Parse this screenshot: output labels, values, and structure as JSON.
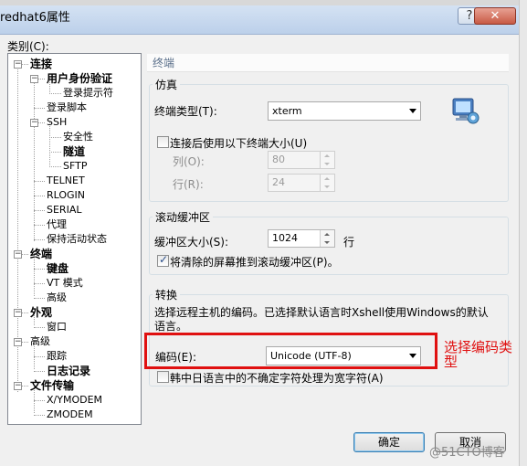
{
  "window": {
    "title": "redhat6属性",
    "help_glyph": "?",
    "close_glyph": "✕"
  },
  "category_label": "类别(C):",
  "tree": [
    {
      "label": "连接",
      "bold": true,
      "expander": "−"
    },
    {
      "label": "用户身份验证",
      "bold": true,
      "expander": "−"
    },
    {
      "label": "登录提示符",
      "bold": false
    },
    {
      "label": "登录脚本",
      "bold": false
    },
    {
      "label": "SSH",
      "bold": false,
      "expander": "−"
    },
    {
      "label": "安全性",
      "bold": false
    },
    {
      "label": "隧道",
      "bold": true
    },
    {
      "label": "SFTP",
      "bold": false
    },
    {
      "label": "TELNET",
      "bold": false
    },
    {
      "label": "RLOGIN",
      "bold": false
    },
    {
      "label": "SERIAL",
      "bold": false
    },
    {
      "label": "代理",
      "bold": false
    },
    {
      "label": "保持活动状态",
      "bold": false
    },
    {
      "label": "终端",
      "bold": true,
      "expander": "−"
    },
    {
      "label": "键盘",
      "bold": true
    },
    {
      "label": "VT 模式",
      "bold": false
    },
    {
      "label": "高级",
      "bold": false
    },
    {
      "label": "外观",
      "bold": true,
      "expander": "−"
    },
    {
      "label": "窗口",
      "bold": false
    },
    {
      "label": "高级",
      "bold": false,
      "expander": "−"
    },
    {
      "label": "跟踪",
      "bold": false
    },
    {
      "label": "日志记录",
      "bold": true
    },
    {
      "label": "文件传输",
      "bold": true,
      "expander": "−"
    },
    {
      "label": "X/YMODEM",
      "bold": false
    },
    {
      "label": "ZMODEM",
      "bold": false
    }
  ],
  "panel": {
    "header": "终端",
    "emulation": {
      "title": "仿真",
      "terminal_type_label": "终端类型(T):",
      "terminal_type_value": "xterm",
      "fixed_size_label": "连接后使用以下终端大小(U)",
      "fixed_size_checked": false,
      "cols_label": "列(O):",
      "cols_value": "80",
      "rows_label": "行(R):",
      "rows_value": "24"
    },
    "scrollback": {
      "title": "滚动缓冲区",
      "size_label": "缓冲区大小(S):",
      "size_value": "1024",
      "unit": "行",
      "push_label": "将清除的屏幕推到滚动缓冲区(P)。",
      "push_checked": true
    },
    "translation": {
      "title": "转换",
      "description": "选择远程主机的编码。已选择默认语言时Xshell使用Windows的默认语言。",
      "encoding_label": "编码(E):",
      "encoding_value": "Unicode (UTF-8)",
      "cjk_label": "韩中日语言中的不确定字符处理为宽字符(A)",
      "cjk_checked": false
    }
  },
  "buttons": {
    "ok": "确定",
    "cancel": "取消"
  },
  "annotation": "选择编码类型",
  "watermark": "@51CTO博客",
  "colors": {
    "annotation_red": "#e01010",
    "titlebar": "#c8d8ee",
    "panel_header_text": "#5a6f8a"
  }
}
